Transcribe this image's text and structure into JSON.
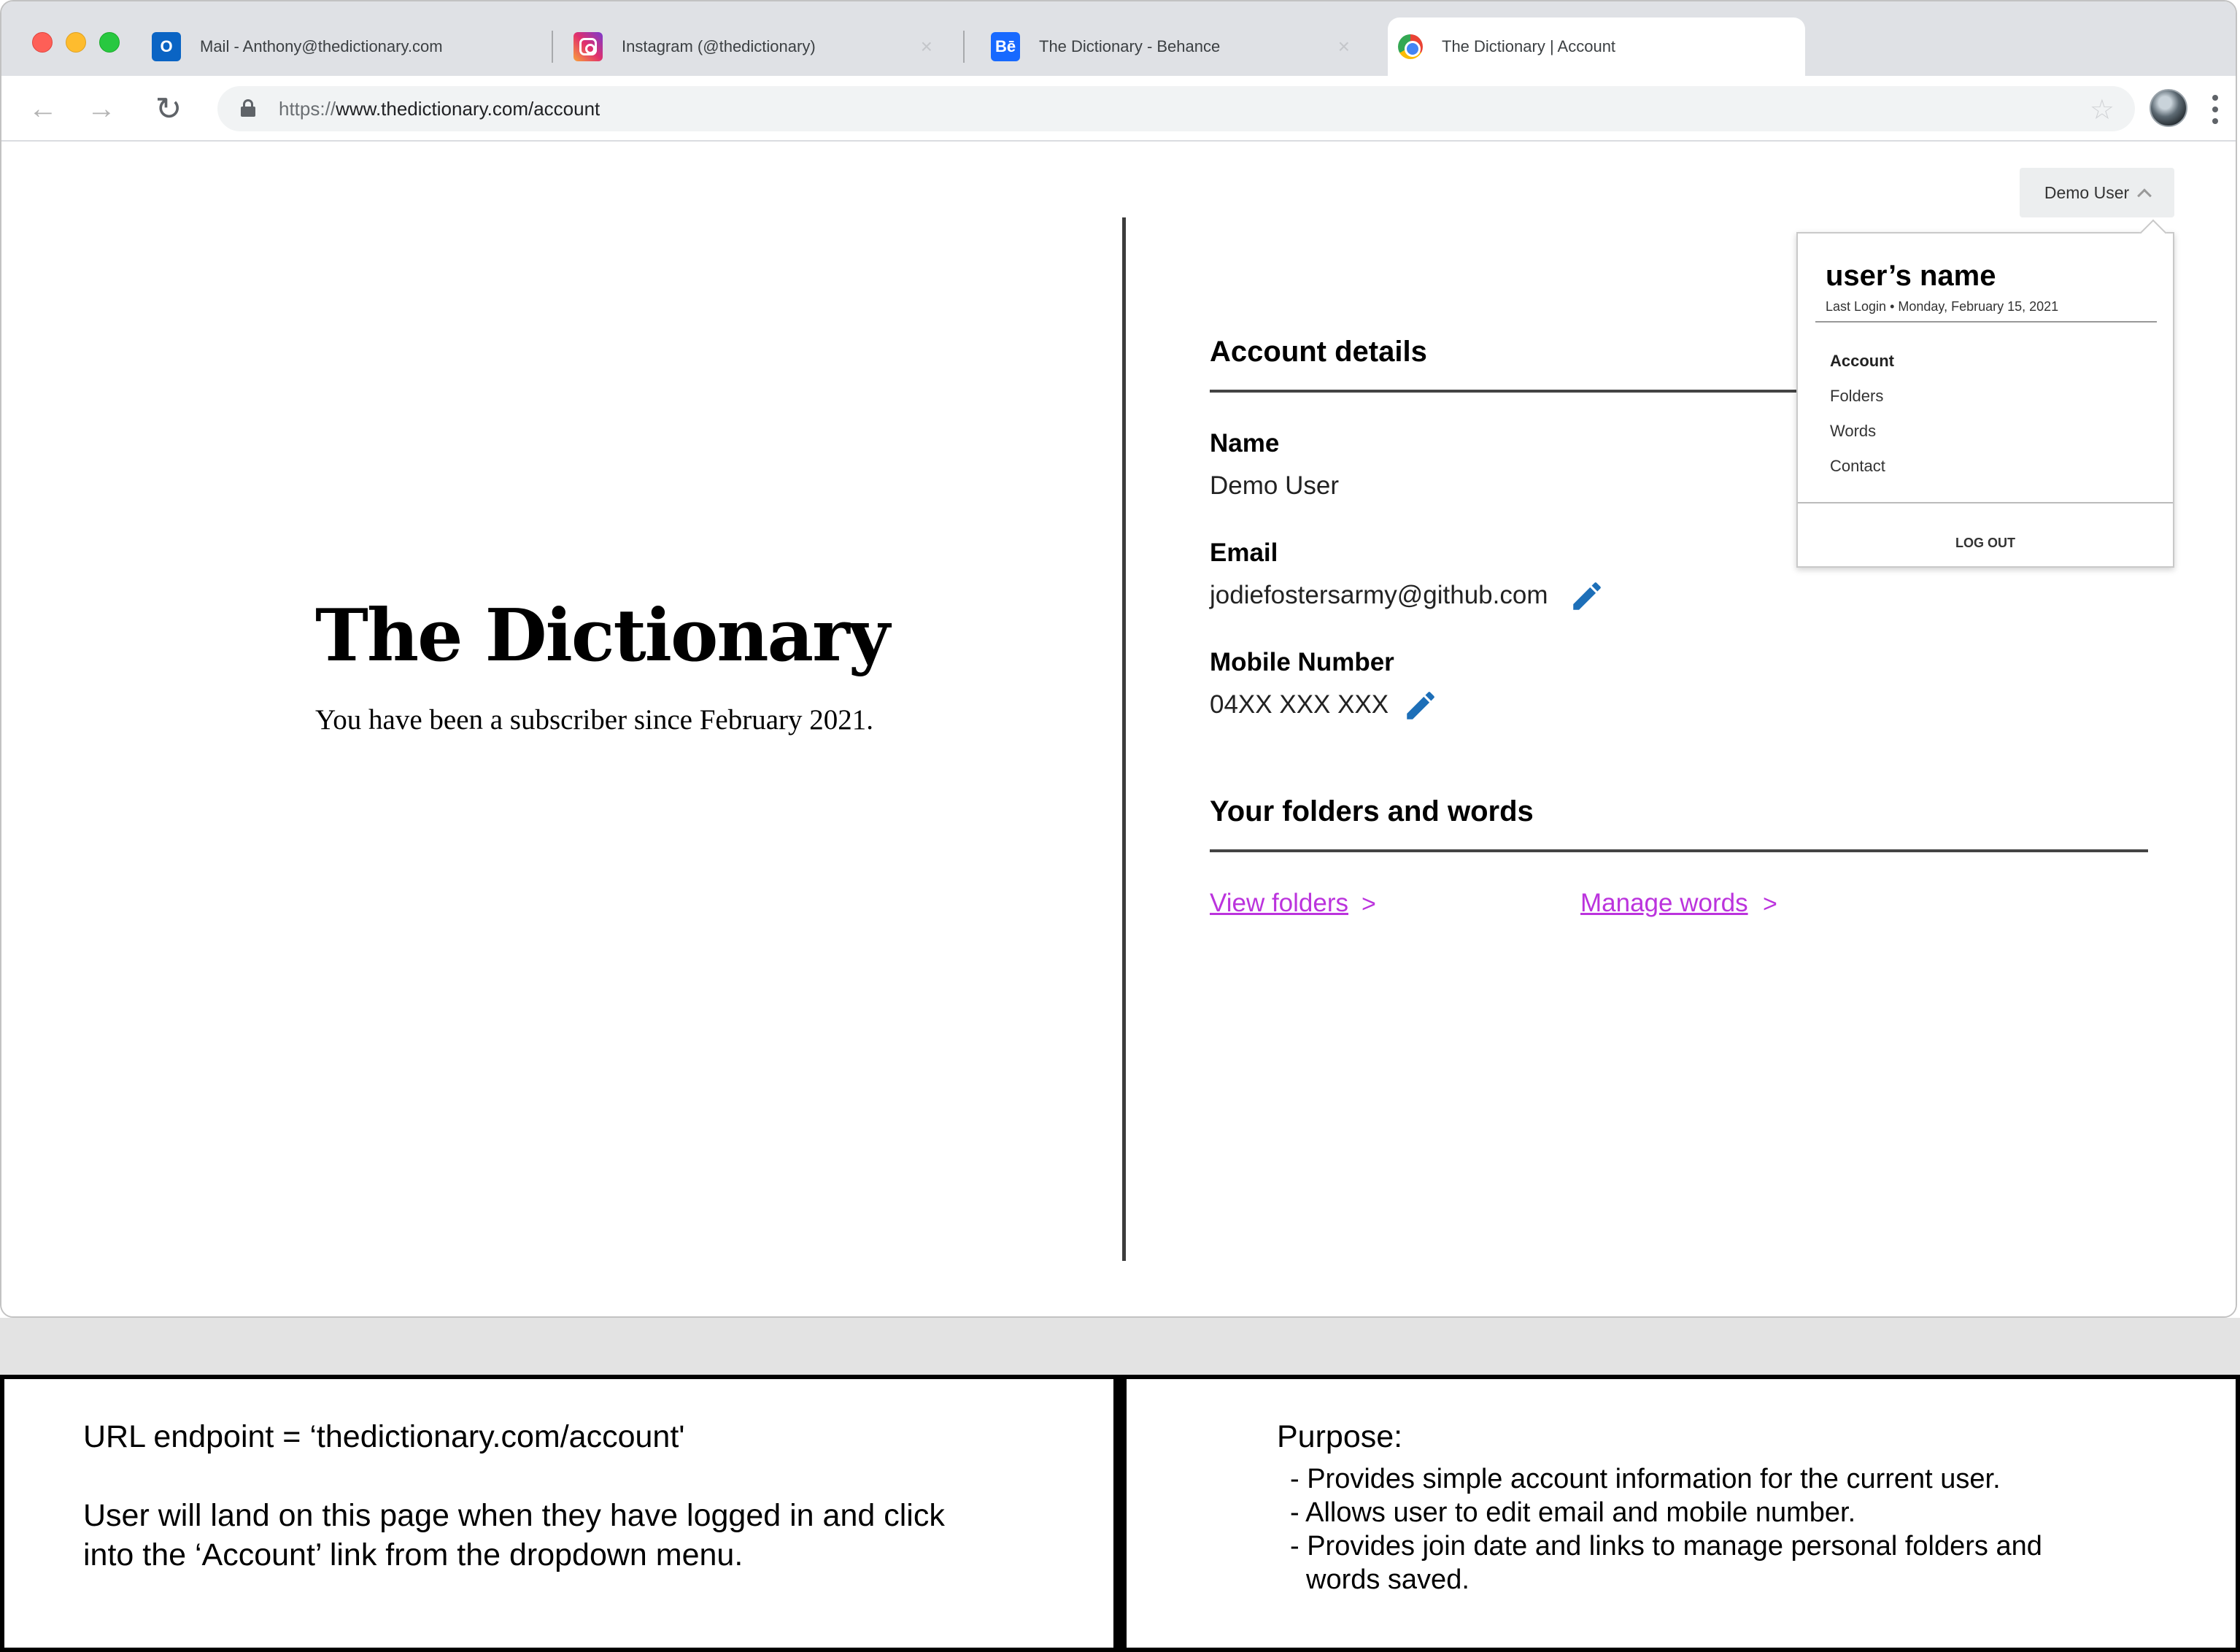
{
  "browser": {
    "tabs": [
      {
        "title": "Mail - Anthony@thedictionary.com",
        "icon": "outlook-icon"
      },
      {
        "title": "Instagram (@thedictionary)",
        "icon": "instagram-icon",
        "close": "×"
      },
      {
        "title": "The Dictionary - Behance",
        "icon": "behance-icon",
        "close": "×"
      },
      {
        "title": "The Dictionary | Account",
        "icon": "chrome-icon"
      }
    ],
    "url_scheme": "https://",
    "url_host_path": "www.thedictionary.com/account"
  },
  "header": {
    "user_button_label": "Demo User"
  },
  "dropdown": {
    "name": "user’s name",
    "last_login": "Last Login • Monday, February 15, 2021",
    "items": [
      "Account",
      "Folders",
      "Words",
      "Contact"
    ],
    "logout": "LOG OUT"
  },
  "brand": {
    "title": "The Dictionary",
    "subscriber_text": "You have been a subscriber since February 2021."
  },
  "account": {
    "title": "Account details",
    "name_label": "Name",
    "name_value": "Demo User",
    "email_label": "Email",
    "email_value": "jodiefostersarmy@github.com",
    "mobile_label": "Mobile Number",
    "mobile_value": "04XX XXX XXX"
  },
  "folders": {
    "title": "Your folders and words",
    "view_folders": "View folders",
    "manage_words": "Manage words",
    "chevron": ">"
  },
  "notes": {
    "left_line1": "URL endpoint = ‘thedictionary.com/account'",
    "left_line2": "User will land on this page when they have logged in and click",
    "left_line3": "into the ‘Account’ link from the dropdown menu.",
    "right_title": "Purpose:",
    "right_bullets": [
      "- Provides simple account information for the current user.",
      "- Allows user to edit email and mobile number.",
      "- Provides join date and links to manage personal folders and",
      "words saved."
    ]
  },
  "colors": {
    "link": "#bb33dd",
    "edit_icon": "#1d6fb8"
  }
}
